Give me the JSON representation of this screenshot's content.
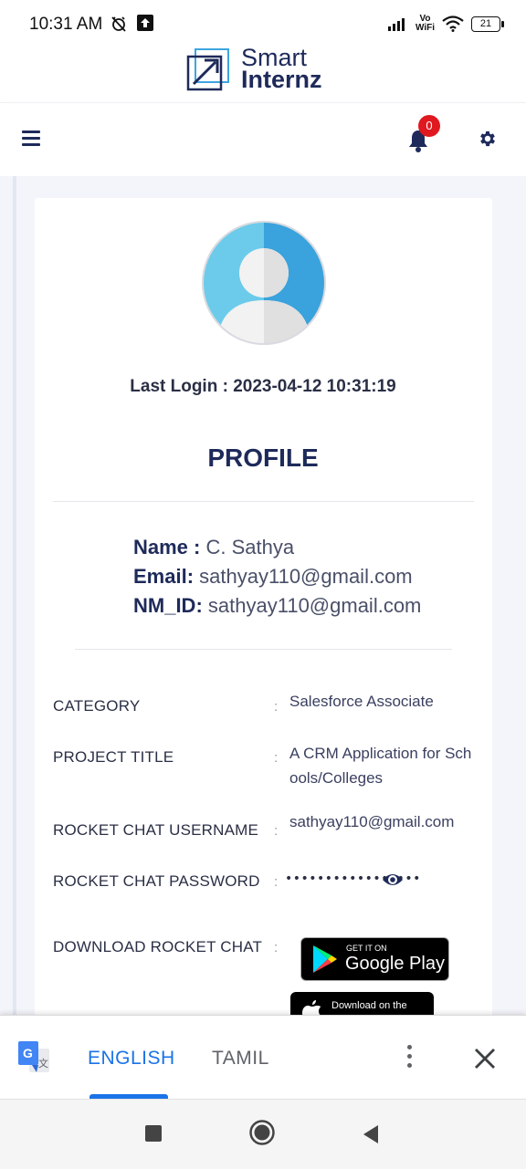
{
  "status_bar": {
    "time": "10:31 AM",
    "vowifi_line1": "Vo",
    "vowifi_line2": "WiFi",
    "battery": "21"
  },
  "logo": {
    "word1": "Smart",
    "word2": "Internz"
  },
  "header": {
    "notification_count": "0"
  },
  "profile": {
    "last_login": "Last Login : 2023-04-12 10:31:19",
    "title": "PROFILE",
    "name_label": "Name :",
    "name_value": "C. Sathya",
    "email_label": "Email:",
    "email_value": "sathyay110@gmail.com",
    "nmid_label": "NM_ID:",
    "nmid_value": "sathyay110@gmail.com"
  },
  "details": {
    "category_label": "CATEGORY",
    "category_value": "Salesforce Associate",
    "project_label": "PROJECT TITLE",
    "project_value": "A CRM Application for Schools/Colleges",
    "rc_user_label": "ROCKET CHAT USERNAME",
    "rc_user_value": "sathyay110@gmail.com",
    "rc_pass_label": "ROCKET CHAT PASSWORD",
    "rc_pass_value": "•••••••••••••••••",
    "download_label": "DOWNLOAD ROCKET CHAT",
    "colon": ":"
  },
  "store_badges": {
    "gplay_small": "GET IT ON",
    "gplay_big": "Google Play",
    "appstore_small": "Download on the"
  },
  "translate_bar": {
    "lang_selected": "ENGLISH",
    "lang_other": "TAMIL"
  }
}
